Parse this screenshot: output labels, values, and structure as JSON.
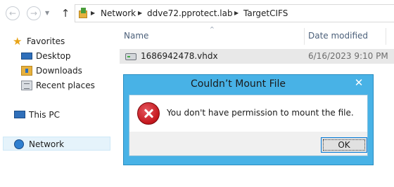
{
  "address_bar": {
    "breadcrumbs": [
      "Network",
      "ddve72.pprotect.lab",
      "TargetCIFS"
    ]
  },
  "nav_pane": {
    "favorites_label": "Favorites",
    "favorites": [
      {
        "label": "Desktop",
        "icon": "desktop-icon"
      },
      {
        "label": "Downloads",
        "icon": "downloads-icon"
      },
      {
        "label": "Recent places",
        "icon": "recent-places-icon"
      }
    ],
    "this_pc_label": "This PC",
    "network_label": "Network"
  },
  "file_list": {
    "columns": {
      "name": "Name",
      "date_modified": "Date modified"
    },
    "rows": [
      {
        "name": "1686942478.vhdx",
        "date_modified": "6/16/2023 9:10 PM"
      }
    ]
  },
  "dialog": {
    "title": "Couldn’t Mount File",
    "close_glyph": "✕",
    "message": "You don't have permission to mount the file.",
    "ok_label": "OK"
  },
  "colors": {
    "dialog_frame": "#48b2e6",
    "error_icon": "#c4161c",
    "selection_background": "#e5f3fb"
  }
}
